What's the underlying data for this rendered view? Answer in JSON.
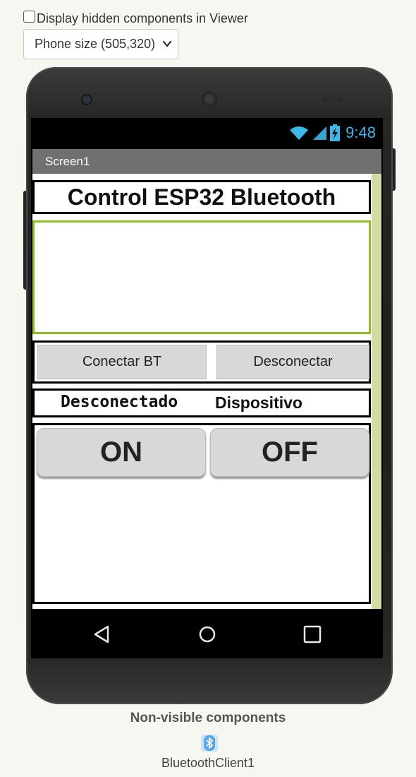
{
  "viewer": {
    "hidden_components_label": "Display hidden components in Viewer",
    "hidden_components_checked": false,
    "size_select_value": "Phone size (505,320)"
  },
  "phone": {
    "status_time": "9:48",
    "screen_title": "Screen1",
    "colors": {
      "title_bar": "#707070",
      "clock": "#3db6e8",
      "listview_border": "#8cbf26",
      "scroll_rail": "#d4dba2"
    }
  },
  "app": {
    "heading": "Control ESP32 Bluetooth",
    "connect_button": "Conectar BT",
    "disconnect_button": "Desconectar",
    "connection_status": "Desconectado",
    "device_label": "Dispositivo",
    "on_button": "ON",
    "off_button": "OFF"
  },
  "nonvisible": {
    "title": "Non-visible components",
    "components": [
      {
        "name": "BluetoothClient1",
        "icon": "bluetooth-icon"
      }
    ]
  },
  "icons": [
    "wifi-icon",
    "cell-signal-icon",
    "battery-charging-icon",
    "back-icon",
    "home-icon",
    "recents-icon",
    "bluetooth-icon",
    "chevron-down-icon"
  ]
}
